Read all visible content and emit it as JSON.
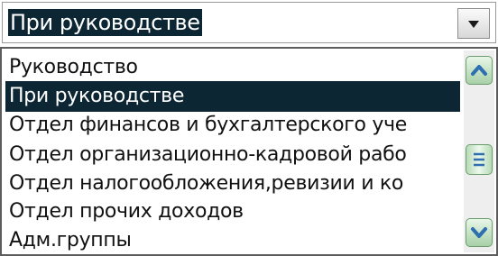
{
  "combo": {
    "selected_value": "При руководстве",
    "dropdown_icon": "triangle-down-icon"
  },
  "list": {
    "items": [
      {
        "label": "Руководство",
        "selected": false
      },
      {
        "label": "При руководстве",
        "selected": true
      },
      {
        "label": "Отдел финансов и бухгалтерского уче",
        "selected": false
      },
      {
        "label": "Отдел организационно-кадровой рабо",
        "selected": false
      },
      {
        "label": "Отдел налогообложения,ревизии и ко",
        "selected": false
      },
      {
        "label": "Отдел прочих доходов",
        "selected": false
      },
      {
        "label": "Адм.группы",
        "selected": false
      }
    ]
  },
  "scrollbar": {
    "up_icon": "chevron-up-icon",
    "down_icon": "chevron-down-icon",
    "thumb_icon": "grip-lines-icon",
    "scroll_position": 0.5
  },
  "colors": {
    "selection": "#0c2733",
    "scroll_accent": "#2f6fb0"
  }
}
